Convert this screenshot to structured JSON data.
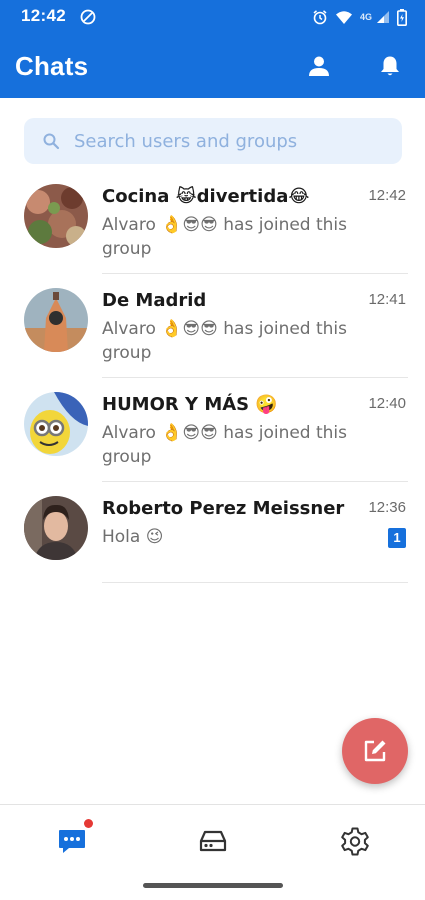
{
  "status_bar": {
    "time": "12:42",
    "network": "4G"
  },
  "header": {
    "title": "Chats"
  },
  "search": {
    "placeholder": "Search users and groups"
  },
  "chats": [
    {
      "name": "Cocina 😹divertida😂",
      "preview": "Alvaro 👌😎😎 has joined this group",
      "time": "12:42"
    },
    {
      "name": "De Madrid",
      "preview": "Alvaro 👌😎😎 has joined this group",
      "time": "12:41"
    },
    {
      "name": "HUMOR Y MÁS 🤪",
      "preview": "Alvaro 👌😎😎 has joined this group",
      "time": "12:40"
    },
    {
      "name": "Roberto Perez Meissner",
      "preview": "Hola 😉",
      "time": "12:36",
      "unread": "1"
    }
  ],
  "bottom_nav": [
    "chats-icon",
    "storage-icon",
    "settings-icon"
  ],
  "colors": {
    "primary": "#1670dc",
    "fab": "#e06666",
    "search_bg": "#e8f1fc",
    "notification_dot": "#e53935"
  }
}
